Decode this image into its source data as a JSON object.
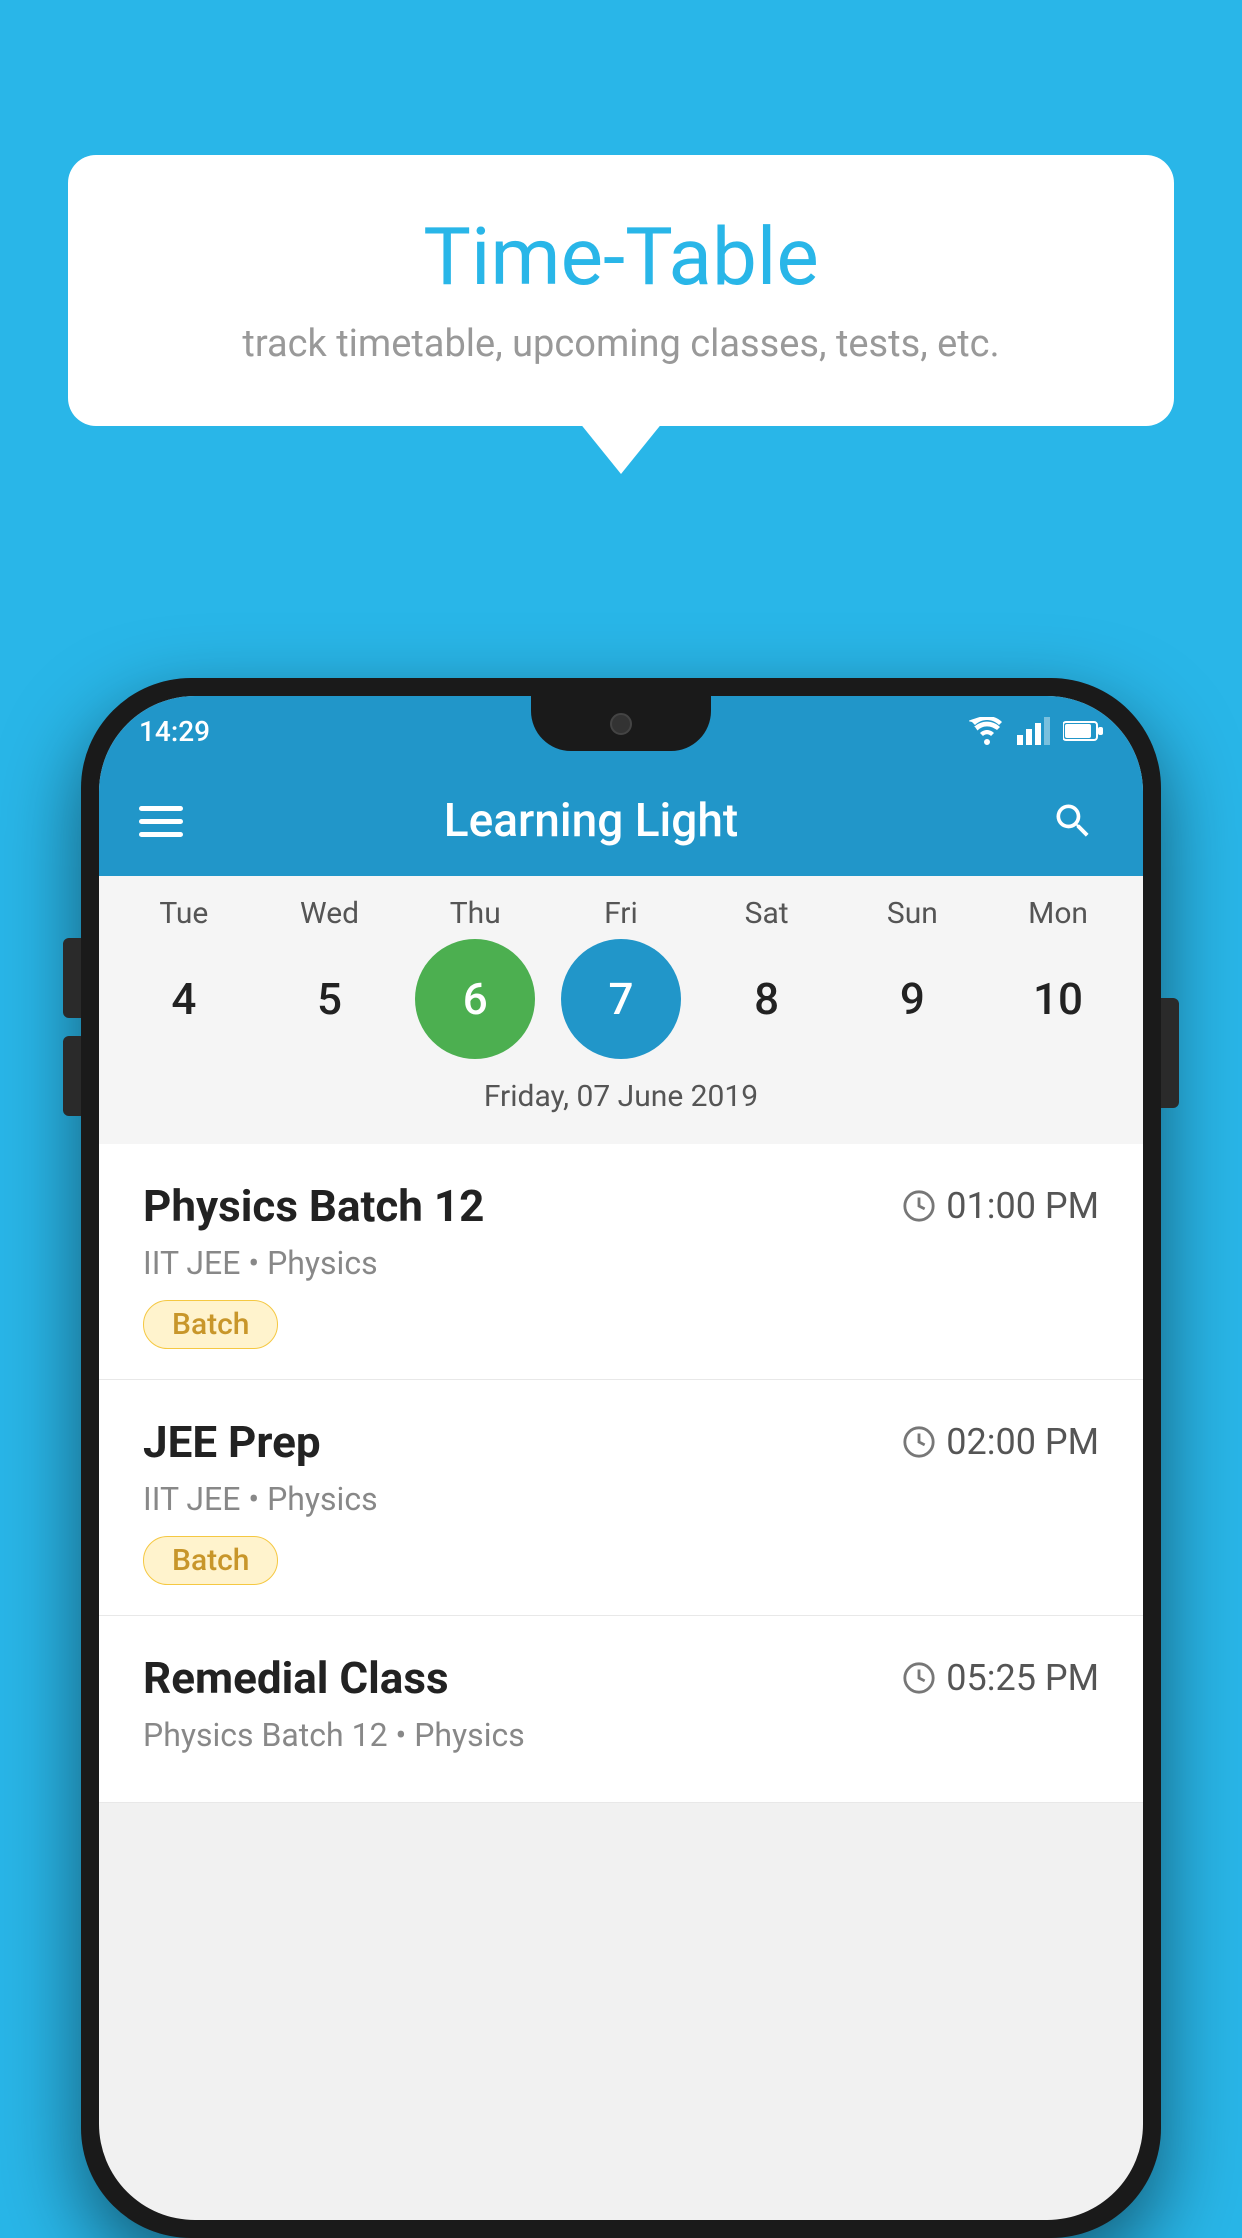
{
  "background_color": "#29b6e8",
  "speech_bubble": {
    "title": "Time-Table",
    "subtitle": "track timetable, upcoming classes, tests, etc."
  },
  "status_bar": {
    "time": "14:29"
  },
  "app_bar": {
    "title": "Learning Light",
    "hamburger_label": "menu",
    "search_label": "search"
  },
  "calendar": {
    "days": [
      {
        "label": "Tue",
        "number": "4"
      },
      {
        "label": "Wed",
        "number": "5"
      },
      {
        "label": "Thu",
        "number": "6",
        "state": "today"
      },
      {
        "label": "Fri",
        "number": "7",
        "state": "selected"
      },
      {
        "label": "Sat",
        "number": "8"
      },
      {
        "label": "Sun",
        "number": "9"
      },
      {
        "label": "Mon",
        "number": "10"
      }
    ],
    "selected_date": "Friday, 07 June 2019"
  },
  "schedule": [
    {
      "name": "Physics Batch 12",
      "time": "01:00 PM",
      "sub": "IIT JEE • Physics",
      "badge": "Batch"
    },
    {
      "name": "JEE Prep",
      "time": "02:00 PM",
      "sub": "IIT JEE • Physics",
      "badge": "Batch"
    },
    {
      "name": "Remedial Class",
      "time": "05:25 PM",
      "sub": "Physics Batch 12 • Physics",
      "badge": ""
    }
  ]
}
